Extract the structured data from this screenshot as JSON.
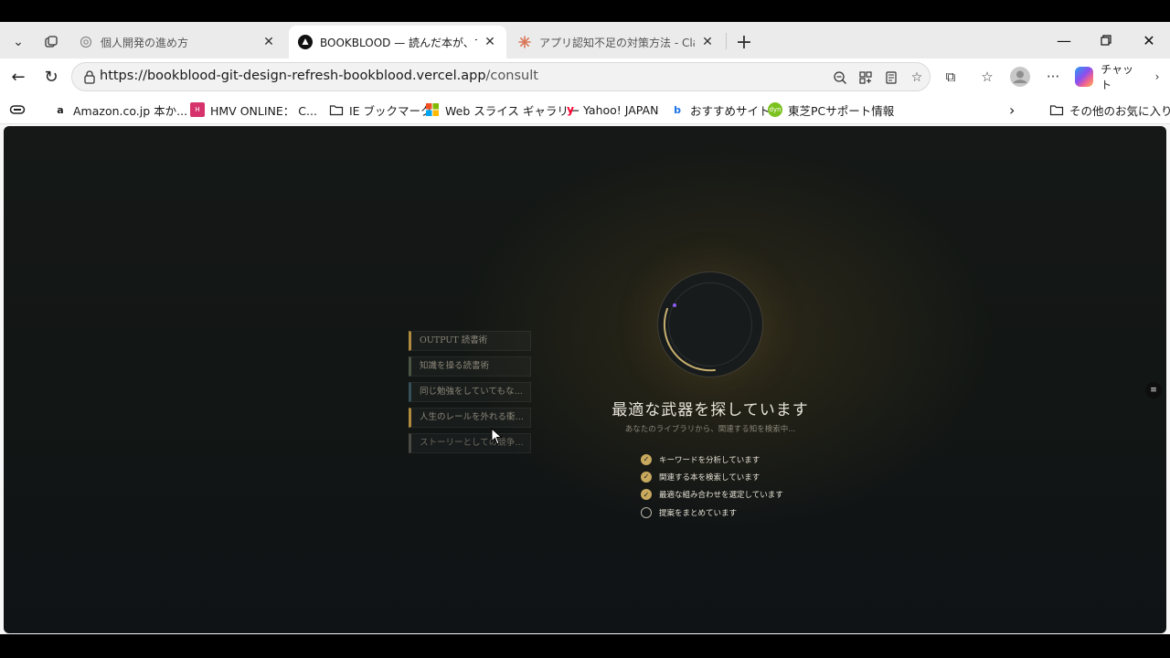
{
  "tabs": [
    {
      "title": "個人開発の進め方",
      "favicon": "openai-icon"
    },
    {
      "title": "BOOKBLOOD — 読んだ本が、すべて",
      "favicon": "vercel-icon"
    },
    {
      "title": "アプリ認知不足の対策方法 - Claude",
      "favicon": "claude-icon"
    }
  ],
  "address_bar": {
    "host": "https://bookblood-git-design-refresh-bookblood.vercel.app",
    "path": "/consult"
  },
  "toolbar": {
    "chat_label": "チャット"
  },
  "bookmarks": [
    {
      "label": "Amazon.co.jp 本か...",
      "icon": "amazon-icon"
    },
    {
      "label": "HMV ONLINE： C...",
      "icon": "hmv-icon"
    },
    {
      "label": "IE ブックマーク",
      "icon": "folder-icon"
    },
    {
      "label": "Web スライス ギャラリー",
      "icon": "microsoft-icon"
    },
    {
      "label": "Yahoo! JAPAN",
      "icon": "yahoo-icon"
    },
    {
      "label": "おすすめサイト",
      "icon": "bing-icon"
    },
    {
      "label": "東芝PCサポート情報",
      "icon": "toshiba-icon"
    }
  ],
  "other_bookmarks": "その他のお気に入り",
  "page": {
    "books": [
      "OUTPUT 読書術",
      "知識を操る読書術",
      "同じ勉強をしていてもなぜ…",
      "人生のレールを外れる衝動…",
      "ストーリーとしての競争戦略"
    ],
    "headline": "最適な武器を探しています",
    "subline": "あなたのライブラリから、関連する知を検索中...",
    "steps": [
      {
        "label": "キーワードを分析しています",
        "done": true
      },
      {
        "label": "関連する本を検索しています",
        "done": true
      },
      {
        "label": "最適な組み合わせを選定しています",
        "done": true
      },
      {
        "label": "提案をまとめています",
        "done": false
      }
    ]
  },
  "colors": {
    "accent_gold": "#c8a95e",
    "background_dark": "#121614",
    "progress_dot": "#8a5cf0"
  }
}
